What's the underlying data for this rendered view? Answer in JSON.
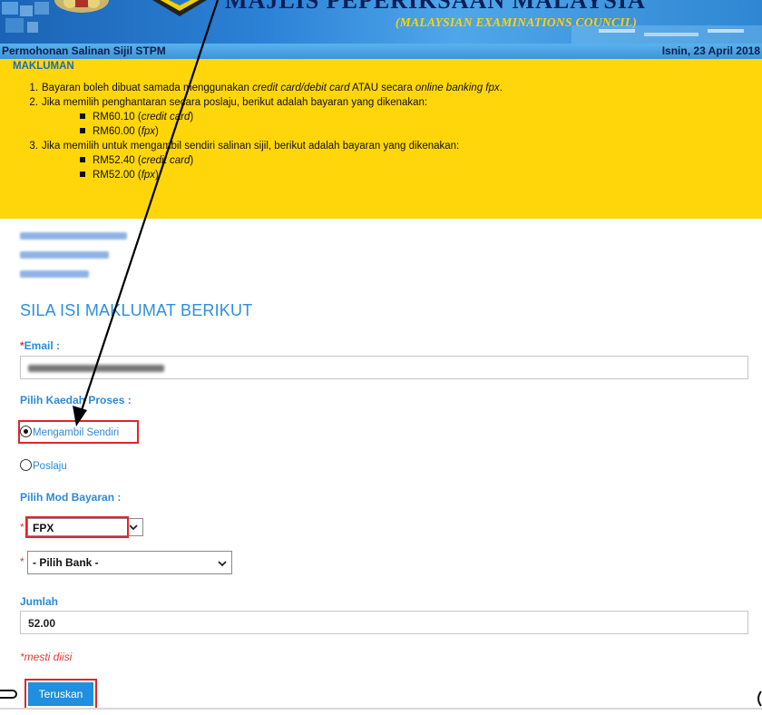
{
  "banner": {
    "header_text_cut": "MAJLIS PEPERIKSAAN MALAYSIA",
    "council": "(MALAYSIAN EXAMINATIONS COUNCIL)"
  },
  "titlebar": {
    "title": "Permohonan Salinan Sijil STPM",
    "date": "Isnin, 23 April 2018"
  },
  "info": {
    "heading": "MAKLUMAN",
    "items": [
      {
        "num": "1.",
        "text_a": "Bayaran boleh dibuat samada menggunakan ",
        "text_b": "credit card/debit card",
        "text_c": " ATAU secara ",
        "text_d": "online banking fpx",
        "text_e": "."
      },
      {
        "num": "2.",
        "text": "Jika memilih penghantaran secara poslaju, berikut adalah bayaran yang dikenakan:",
        "sub": [
          {
            "amount": "RM60.10 (",
            "method": "credit card",
            "close": ")"
          },
          {
            "amount": "RM60.00 (",
            "method": "fpx",
            "close": ")"
          }
        ]
      },
      {
        "num": "3.",
        "text": "Jika memilih untuk mengambil sendiri salinan sijil, berikut adalah bayaran yang dikenakan:",
        "sub": [
          {
            "amount": "RM52.40 (",
            "method": "credit card",
            "close": ")"
          },
          {
            "amount": "RM52.00 (",
            "method": "fpx",
            "close": ")"
          }
        ]
      }
    ]
  },
  "form": {
    "section_title": "SILA ISI MAKLUMAT BERIKUT",
    "required_mark": "*",
    "email_label": "Email :",
    "process_label": "Pilih Kaedah Proses :",
    "process_options": [
      "Mengambil Sendiri",
      "Poslaju"
    ],
    "process_selected": "Mengambil Sendiri",
    "payment_label": "Pilih Mod Bayaran :",
    "payment_mode_value": "FPX",
    "bank_value": "- Pilih Bank -",
    "amount_label": "Jumlah",
    "amount_value": "52.00",
    "required_note": "*mesti diisi",
    "submit_label": "Teruskan"
  },
  "colors": {
    "accent_blue": "#2a8adb",
    "info_yellow": "#ffd60a",
    "highlight_red": "#e0242b",
    "required_red": "#e53935"
  }
}
